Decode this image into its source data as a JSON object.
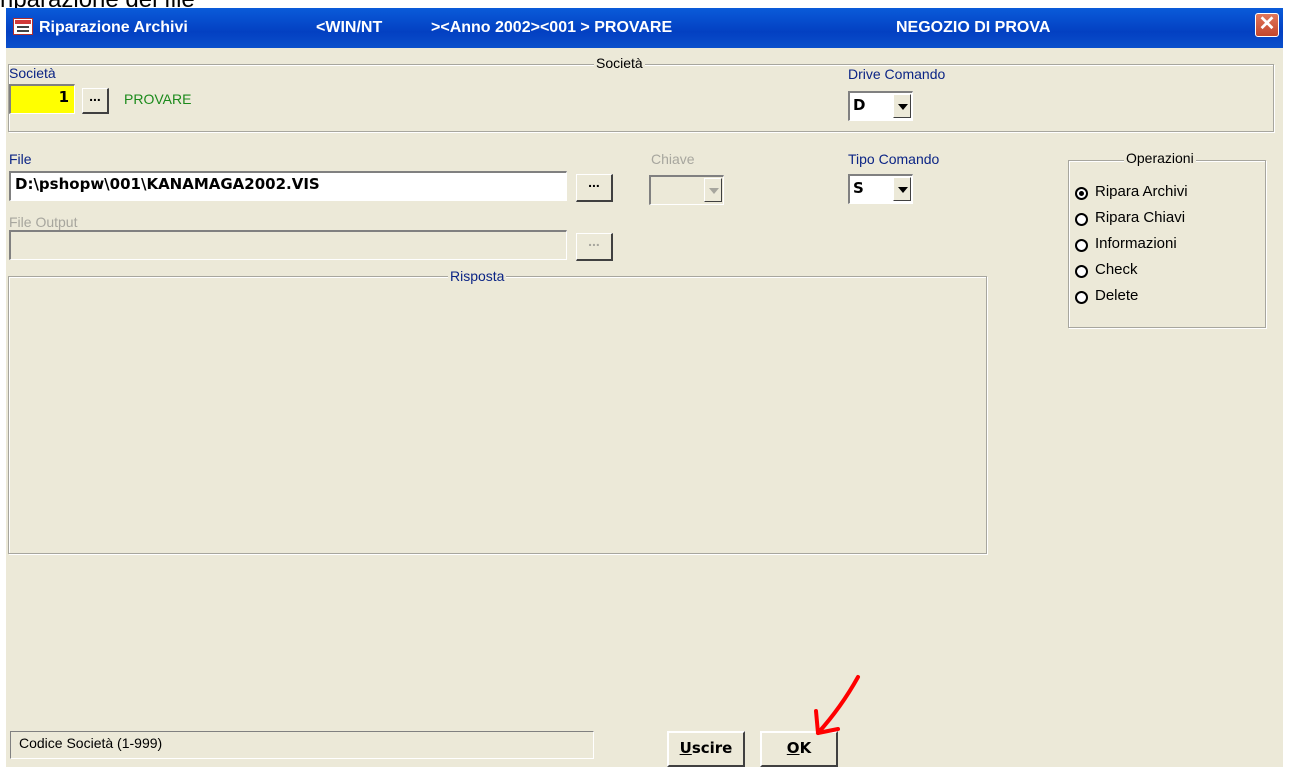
{
  "caption": "riparazione del file",
  "titlebar": {
    "title": "Riparazione Archivi",
    "env": "<WIN/NT",
    "context": "><Anno 2002><001 > PROVARE",
    "shop": "NEGOZIO DI PROVA"
  },
  "societa_group": {
    "title": "Società",
    "societa_label": "Società",
    "societa_value": "1",
    "browse_label": "...",
    "societa_name": "PROVARE",
    "drive_label": "Drive Comando",
    "drive_value": "D"
  },
  "file_section": {
    "file_label": "File",
    "file_value": "D:\\pshopw\\001\\KANAMAGA2002.VIS",
    "browse_label": "...",
    "chiave_label": "Chiave",
    "chiave_value": "",
    "tipo_label": "Tipo Comando",
    "tipo_value": "S",
    "output_label": "File Output",
    "output_value": ""
  },
  "operazioni": {
    "title": "Operazioni",
    "options": [
      {
        "label": "Ripara Archivi",
        "checked": true
      },
      {
        "label": "Ripara Chiavi",
        "checked": false
      },
      {
        "label": "Informazioni",
        "checked": false
      },
      {
        "label": "Check",
        "checked": false
      },
      {
        "label": "Delete",
        "checked": false
      }
    ]
  },
  "risposta": {
    "title": "Risposta"
  },
  "statusbar": {
    "text": "Codice Società (1-999)"
  },
  "buttons": {
    "uscire_first": "U",
    "uscire_rest": "scire",
    "ok_first": "O",
    "ok_rest": "K"
  },
  "colors": {
    "title_blue": "#0a4fcb",
    "window_bg": "#ece9d8",
    "label_blue": "#0b2485",
    "company_green": "#1b8a1b",
    "societa_yellow": "#ffff00",
    "annotation_red": "#ff0000"
  },
  "icons": {
    "app_icon": "form-window-icon",
    "close": "close-icon",
    "annotation": "red-arrow-icon"
  }
}
